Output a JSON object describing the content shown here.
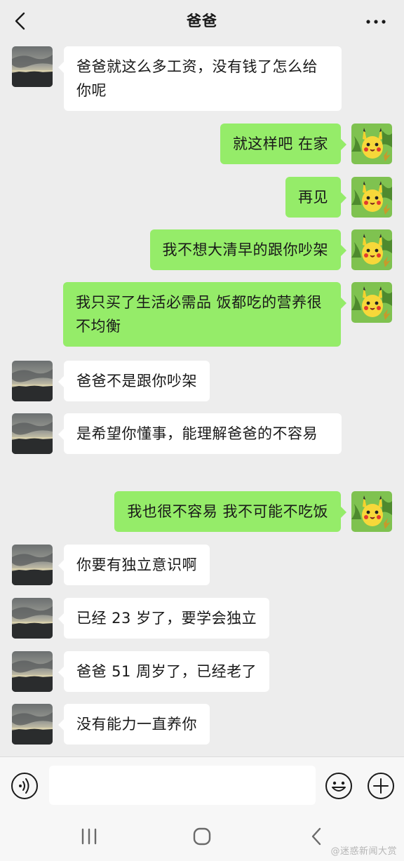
{
  "header": {
    "title": "爸爸",
    "back_icon": "chevron-left-icon",
    "more_icon": "more-dots-icon"
  },
  "contacts": {
    "dad_avatar": "sunset-landscape-avatar",
    "me_avatar": "pikachu-avatar"
  },
  "messages": [
    {
      "sender": "dad",
      "text": "爸爸就这么多工资，没有钱了怎么给你呢"
    },
    {
      "sender": "me",
      "text": "就这样吧 在家"
    },
    {
      "sender": "me",
      "text": "再见"
    },
    {
      "sender": "me",
      "text": "我不想大清早的跟你吵架"
    },
    {
      "sender": "me",
      "text": "我只买了生活必需品 饭都吃的营养很不均衡"
    },
    {
      "sender": "dad",
      "text": "爸爸不是跟你吵架"
    },
    {
      "sender": "dad",
      "text": "是希望你懂事，能理解爸爸的不容易"
    },
    {
      "sender": "me",
      "text": "我也很不容易 我不可能不吃饭"
    },
    {
      "sender": "dad",
      "text": "你要有独立意识啊"
    },
    {
      "sender": "dad",
      "text": "已经 23 岁了，要学会独立"
    },
    {
      "sender": "dad",
      "text": "爸爸 51 周岁了，已经老了"
    },
    {
      "sender": "dad",
      "text": "没有能力一直养你"
    }
  ],
  "input_bar": {
    "voice_icon": "voice-icon",
    "text_value": "",
    "emoji_icon": "emoji-icon",
    "plus_icon": "plus-icon"
  },
  "system_nav": {
    "recent_icon": "recent-apps-icon",
    "home_icon": "home-icon",
    "back_icon": "nav-back-icon"
  },
  "watermark": "@迷惑新闻大赏",
  "colors": {
    "background": "#ededed",
    "incoming_bubble": "#ffffff",
    "outgoing_bubble": "#95ec69",
    "text": "#191919"
  }
}
